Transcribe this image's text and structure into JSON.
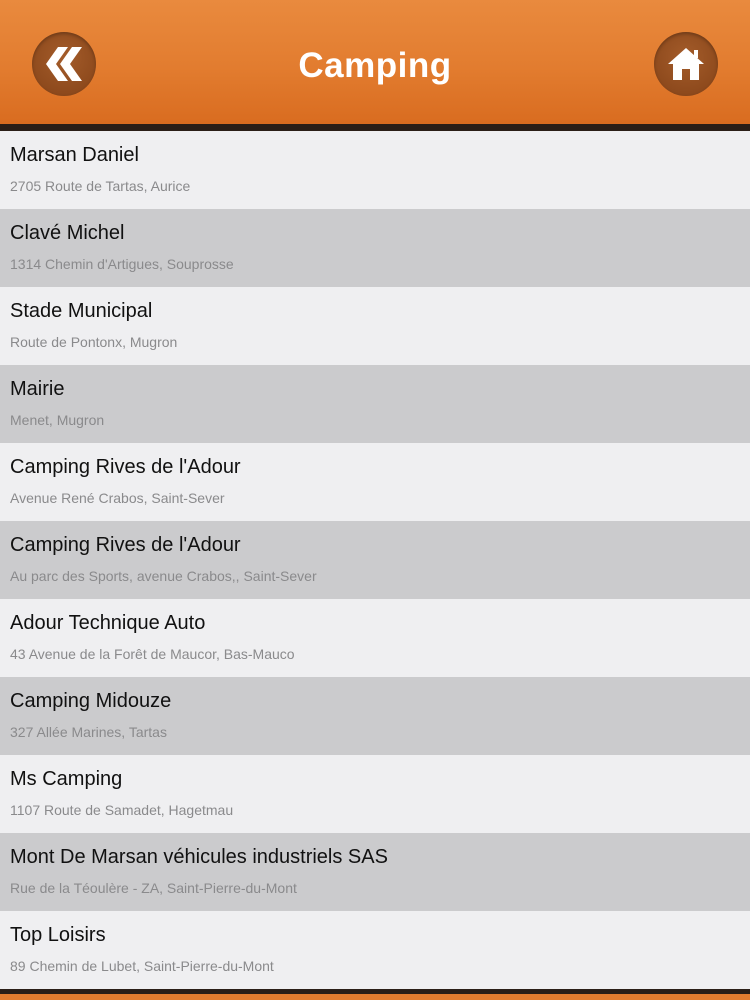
{
  "header": {
    "title": "Camping",
    "back_icon": "double-chevron-left-icon",
    "home_icon": "home-icon",
    "color": "#e27c2f"
  },
  "items": [
    {
      "name": "Marsan Daniel",
      "address": "2705 Route de Tartas, Aurice"
    },
    {
      "name": "Clavé Michel",
      "address": "1314 Chemin d'Artigues, Souprosse"
    },
    {
      "name": "Stade Municipal",
      "address": "Route de Pontonx, Mugron"
    },
    {
      "name": "Mairie",
      "address": "Menet, Mugron"
    },
    {
      "name": "Camping Rives de l'Adour",
      "address": "Avenue René Crabos, Saint-Sever"
    },
    {
      "name": "Camping Rives de l'Adour",
      "address": "Au parc des Sports, avenue Crabos,, Saint-Sever"
    },
    {
      "name": "Adour Technique Auto",
      "address": "43 Avenue de la Forêt de Maucor, Bas-Mauco"
    },
    {
      "name": "Camping Midouze",
      "address": "327 Allée Marines, Tartas"
    },
    {
      "name": "Ms Camping",
      "address": "1107 Route de Samadet, Hagetmau"
    },
    {
      "name": "Mont De Marsan véhicules industriels SAS",
      "address": "Rue de la Téoulère - ZA, Saint-Pierre-du-Mont"
    },
    {
      "name": "Top Loisirs",
      "address": "89 Chemin de Lubet, Saint-Pierre-du-Mont"
    }
  ]
}
